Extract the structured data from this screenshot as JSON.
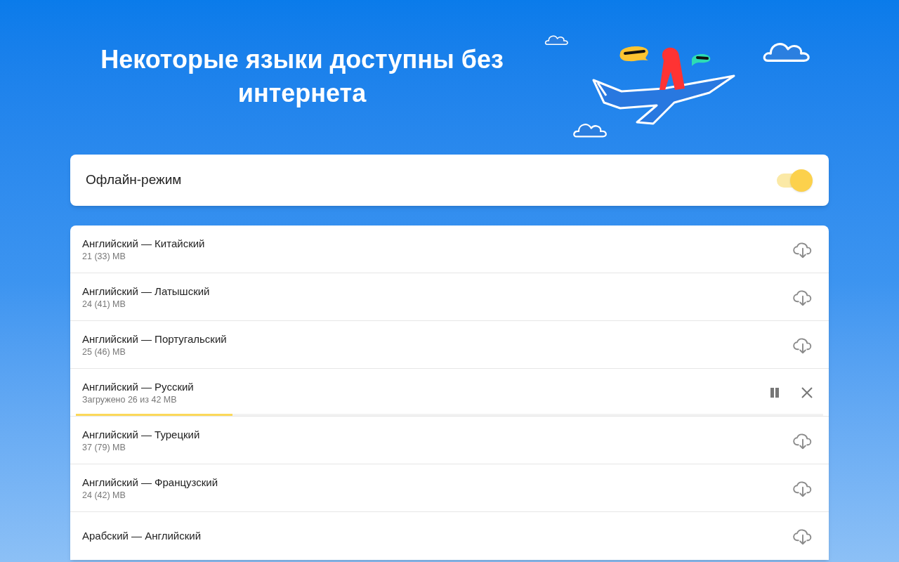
{
  "title": "Некоторые языки доступны без интернета",
  "offline_mode": {
    "label": "Офлайн-режим",
    "on": true
  },
  "languages": [
    {
      "kind": "available",
      "name": "Английский — Китайский",
      "size": "21 (33) MB"
    },
    {
      "kind": "available",
      "name": "Английский — Латышский",
      "size": "24 (41) MB"
    },
    {
      "kind": "available",
      "name": "Английский — Португальский",
      "size": "25 (46) MB"
    },
    {
      "kind": "downloading",
      "name": "Английский — Русский",
      "size": "Загружено 26 из 42 MB",
      "level": 0.21
    },
    {
      "kind": "available",
      "name": "Английский — Турецкий",
      "size": "37 (79) MB"
    },
    {
      "kind": "available",
      "name": "Английский — Французский",
      "size": "24 (42) MB"
    },
    {
      "kind": "available",
      "name": "Арабский — Английский"
    }
  ]
}
